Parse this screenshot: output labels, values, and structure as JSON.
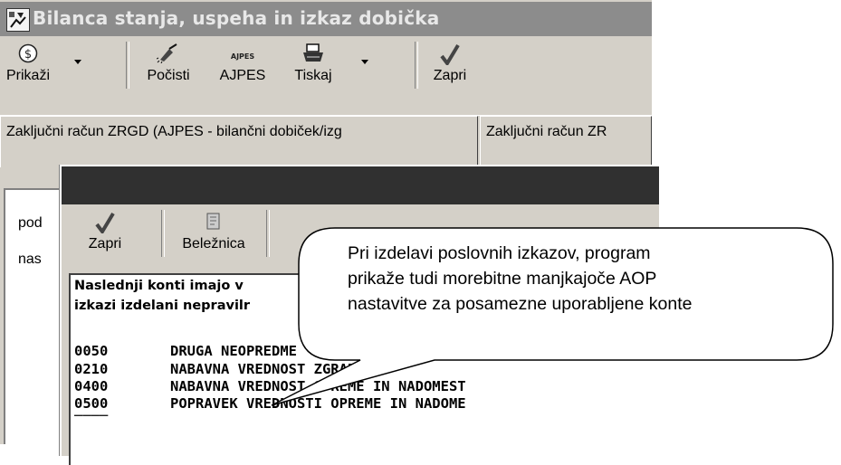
{
  "window": {
    "title": "Bilanca stanja, uspeha in izkaz dobička"
  },
  "toolbar": {
    "buttons": [
      {
        "label": "Prikaži",
        "icon": "dollar-icon"
      },
      {
        "label": "Počisti",
        "icon": "broom-icon"
      },
      {
        "label": "AJPES",
        "icon": "ajpes-logo-icon"
      },
      {
        "label": "Tiskaj",
        "icon": "printer-icon"
      },
      {
        "label": "Zapri",
        "icon": "checkmark-icon"
      }
    ]
  },
  "tabs": {
    "row1": [
      "Zaključni račun ZRGD (AJPES - bilančni dobiček/izg",
      "Zaključni račun ZR"
    ]
  },
  "panel": {
    "lines": [
      "pod",
      "nas"
    ]
  },
  "dialog": {
    "toolbar": {
      "buttons": [
        {
          "label": "Zapri",
          "icon": "checkmark-icon"
        },
        {
          "label": "Beležnica",
          "icon": "notepad-icon"
        }
      ]
    },
    "header": [
      "Naslednji konti imajo v",
      "izkazi izdelani nepravilr"
    ],
    "rows": [
      {
        "code": "0050",
        "name": "DRUGA NEOPREDME"
      },
      {
        "code": "0210",
        "name": "NABAVNA VREDNOST ZGRADB"
      },
      {
        "code": "0400",
        "name": "NABAVNA VREDNOST OPREME IN NADOMEST"
      },
      {
        "code": "0500",
        "name": "POPRAVEK VREDNOSTI OPREME IN NADOME"
      }
    ]
  },
  "callout": {
    "lines": [
      "Pri izdelavi poslovnih izkazov, program",
      "prikaže tudi morebitne manjkajoče AOP",
      "nastavitve za posamezne uporabljene konte"
    ]
  }
}
